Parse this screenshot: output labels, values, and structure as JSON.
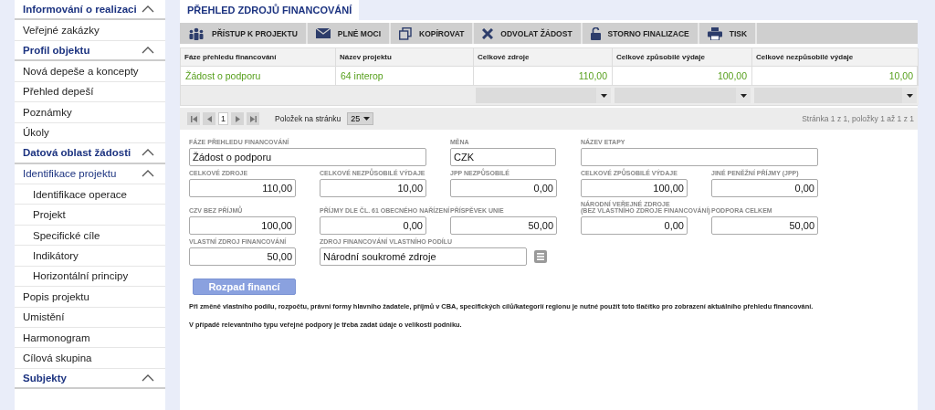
{
  "sidebar": {
    "items": [
      {
        "label": "Informování o realizaci",
        "expanded": true,
        "children": [
          {
            "label": "Veřejné zakázky"
          }
        ]
      },
      {
        "label": "Profil objektu",
        "expanded": true,
        "children": [
          {
            "label": "Nová depeše a koncepty"
          },
          {
            "label": "Přehled depeší"
          },
          {
            "label": "Poznámky"
          },
          {
            "label": "Úkoly"
          }
        ]
      },
      {
        "label": "Datová oblast žádosti",
        "expanded": true,
        "children": [
          {
            "label": "Identifikace projektu",
            "expanded": true,
            "children": [
              {
                "label": "Identifikace operace"
              },
              {
                "label": "Projekt"
              },
              {
                "label": "Specifické cíle"
              },
              {
                "label": "Indikátory"
              },
              {
                "label": "Horizontální principy"
              }
            ]
          },
          {
            "label": "Popis projektu"
          },
          {
            "label": "Umistění"
          },
          {
            "label": "Harmonogram"
          },
          {
            "label": "Cílová skupina"
          }
        ]
      },
      {
        "label": "Subjekty",
        "expanded": true
      }
    ]
  },
  "tabs": [
    {
      "label": "PŘEHLED ZDROJŮ FINANCOVÁNÍ",
      "selected": true
    }
  ],
  "toolbar": [
    "PŘÍSTUP K PROJEKTU",
    "PLNÉ MOCI",
    "KOPÍROVAT",
    "ODVOLAT ŽÁDOST",
    "STORNO FINALIZACE",
    "TISK"
  ],
  "table": {
    "columns": [
      "Fáze přehledu financování",
      "Název projektu",
      "Celkové zdroje",
      "Celkové způsobilé výdaje",
      "Celkové nezpůsobilé výdaje"
    ],
    "rows": [
      [
        "Žádost o podporu",
        "64 interop",
        "110,00",
        "100,00",
        "10,00"
      ]
    ],
    "filters": [
      {
        "kind": "none"
      },
      {
        "kind": "none"
      },
      {
        "kind": "dropdown"
      },
      {
        "kind": "dropdown"
      },
      {
        "kind": "dropdown"
      }
    ]
  },
  "pager": {
    "page": "1",
    "per_page_label": "Položek na stránku",
    "per_page": "25",
    "summary": "Stránka 1 z 1, položky 1 až 1 z 1"
  },
  "form": {
    "rows": [
      [
        {
          "label": "FÁZE PŘEHLEDU FINANCOVÁNÍ",
          "value": "Žádost o podporu",
          "kind": "text"
        },
        "",
        {
          "label": "MĚNA",
          "value": "CZK",
          "kind": "code"
        },
        {
          "label": "NÁZEV ETAPY",
          "kind": "text"
        },
        ""
      ],
      [
        {
          "label": "CELKOVÉ ZDROJE",
          "value": "110,00",
          "kind": "amount"
        },
        {
          "label": "CELKOVÉ NEZPŮSOBILÉ VÝDAJE",
          "value": "10,00",
          "kind": "amount"
        },
        {
          "label": "JPP NEZPŮSOBILÉ",
          "value": "0,00",
          "kind": "amount"
        },
        {
          "label": "CELKOVÉ ZPŮSOBILÉ VÝDAJE",
          "value": "100,00",
          "kind": "amount"
        },
        {
          "label": "JINÉ PENĚŽNÍ PŘÍJMY (JPP)",
          "value": "0,00",
          "kind": "amount"
        }
      ],
      [
        {
          "label": "CZV BEZ PŘÍJMŮ",
          "value": "100,00",
          "kind": "amount"
        },
        {
          "label": "PŘÍJMY DLE ČL. 61 OBECNÉHO NAŘÍZENÍ",
          "value": "0,00",
          "kind": "amount"
        },
        {
          "label": "PŘÍSPĚVEK UNIE",
          "value": "50,00",
          "kind": "amount"
        },
        {
          "label": "NÁRODNÍ VEŘEJNÉ ZDROJE\n(BEZ VLASTNÍHO ZDROJE FINANCOVÁNÍ)",
          "value": "0,00",
          "kind": "amount"
        },
        {
          "label": "PODPORA CELKEM",
          "value": "50,00",
          "kind": "amount"
        }
      ],
      [
        {
          "label": "VLASTNÍ ZDROJ FINANCOVÁNÍ",
          "value": "50,00",
          "kind": "amount"
        },
        {
          "label": "ZDROJ FINANCOVÁNÍ VLASTNÍHO PODÍLU",
          "value": "Národní soukromé zdroje",
          "kind": "select"
        },
        "",
        "",
        ""
      ]
    ],
    "button": "Rozpad financí",
    "notes": [
      "Při změně vlastního podílu, rozpočtu, právní formy hlavního žadatele, příjmů v CBA, specifických cílů/kategorií regionu je nutné použít toto tlačítko pro zobrazení aktuálního přehledu financování.",
      "V případě relevantního typu veřejné podpory je třeba zadat údaje o velikosti podniku."
    ]
  }
}
